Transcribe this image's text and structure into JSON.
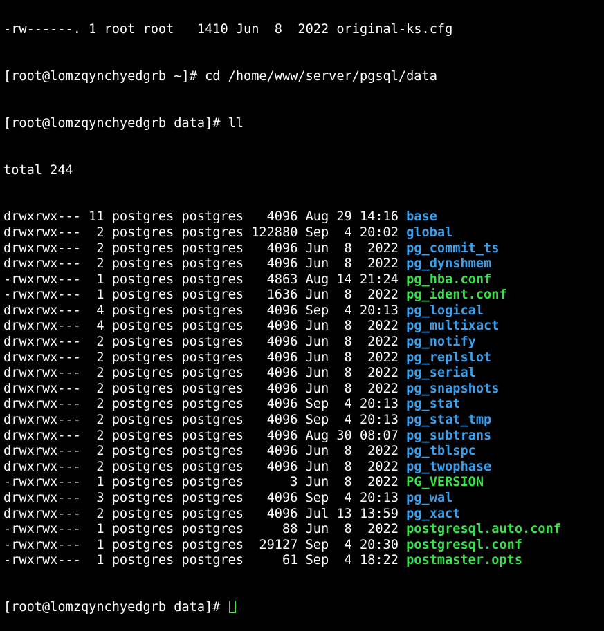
{
  "terminal": {
    "top_partial": "-rw------. 1 root root   1410 Jun  8  2022 original-ks.cfg",
    "prompt1": "[root@lomzqynchyedgrb ~]# cd /home/www/server/pgsql/data",
    "prompt2": "[root@lomzqynchyedgrb data]# ll",
    "total": "total 244",
    "entries": [
      {
        "meta": "drwxrwx--- 11 postgres postgres   4096 Aug 29 14:16 ",
        "name": "base",
        "type": "dir"
      },
      {
        "meta": "drwxrwx---  2 postgres postgres 122880 Sep  4 20:02 ",
        "name": "global",
        "type": "dir"
      },
      {
        "meta": "drwxrwx---  2 postgres postgres   4096 Jun  8  2022 ",
        "name": "pg_commit_ts",
        "type": "dir"
      },
      {
        "meta": "drwxrwx---  2 postgres postgres   4096 Jun  8  2022 ",
        "name": "pg_dynshmem",
        "type": "dir"
      },
      {
        "meta": "-rwxrwx---  1 postgres postgres   4863 Aug 14 21:24 ",
        "name": "pg_hba.conf",
        "type": "file"
      },
      {
        "meta": "-rwxrwx---  1 postgres postgres   1636 Jun  8  2022 ",
        "name": "pg_ident.conf",
        "type": "file"
      },
      {
        "meta": "drwxrwx---  4 postgres postgres   4096 Sep  4 20:13 ",
        "name": "pg_logical",
        "type": "dir"
      },
      {
        "meta": "drwxrwx---  4 postgres postgres   4096 Jun  8  2022 ",
        "name": "pg_multixact",
        "type": "dir"
      },
      {
        "meta": "drwxrwx---  2 postgres postgres   4096 Jun  8  2022 ",
        "name": "pg_notify",
        "type": "dir"
      },
      {
        "meta": "drwxrwx---  2 postgres postgres   4096 Jun  8  2022 ",
        "name": "pg_replslot",
        "type": "dir"
      },
      {
        "meta": "drwxrwx---  2 postgres postgres   4096 Jun  8  2022 ",
        "name": "pg_serial",
        "type": "dir"
      },
      {
        "meta": "drwxrwx---  2 postgres postgres   4096 Jun  8  2022 ",
        "name": "pg_snapshots",
        "type": "dir"
      },
      {
        "meta": "drwxrwx---  2 postgres postgres   4096 Sep  4 20:13 ",
        "name": "pg_stat",
        "type": "dir"
      },
      {
        "meta": "drwxrwx---  2 postgres postgres   4096 Sep  4 20:13 ",
        "name": "pg_stat_tmp",
        "type": "dir"
      },
      {
        "meta": "drwxrwx---  2 postgres postgres   4096 Aug 30 08:07 ",
        "name": "pg_subtrans",
        "type": "dir"
      },
      {
        "meta": "drwxrwx---  2 postgres postgres   4096 Jun  8  2022 ",
        "name": "pg_tblspc",
        "type": "dir"
      },
      {
        "meta": "drwxrwx---  2 postgres postgres   4096 Jun  8  2022 ",
        "name": "pg_twophase",
        "type": "dir"
      },
      {
        "meta": "-rwxrwx---  1 postgres postgres      3 Jun  8  2022 ",
        "name": "PG_VERSION",
        "type": "file"
      },
      {
        "meta": "drwxrwx---  3 postgres postgres   4096 Sep  4 20:13 ",
        "name": "pg_wal",
        "type": "dir"
      },
      {
        "meta": "drwxrwx---  2 postgres postgres   4096 Jul 13 13:59 ",
        "name": "pg_xact",
        "type": "dir"
      },
      {
        "meta": "-rwxrwx---  1 postgres postgres     88 Jun  8  2022 ",
        "name": "postgresql.auto.conf",
        "type": "file"
      },
      {
        "meta": "-rwxrwx---  1 postgres postgres  29127 Sep  4 20:30 ",
        "name": "postgresql.conf",
        "type": "file"
      },
      {
        "meta": "-rwxrwx---  1 postgres postgres     61 Sep  4 18:22 ",
        "name": "postmaster.opts",
        "type": "file"
      }
    ],
    "prompt_final": "[root@lomzqynchyedgrb data]# ",
    "colors": {
      "background": "#000000",
      "text": "#ffffff",
      "directory": "#3aa0ee",
      "file": "#39e04a",
      "cursor": "#3de03d"
    }
  }
}
